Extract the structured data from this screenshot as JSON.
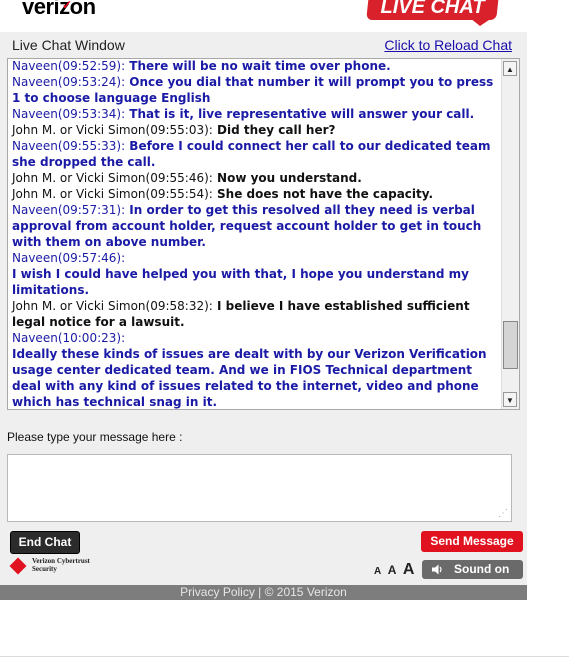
{
  "brand": {
    "logo_text": "verizon",
    "logo_check": "✓",
    "badge_text": "LIVE CHAT"
  },
  "window": {
    "title": "Live Chat Window",
    "reload_link": "Click to Reload Chat"
  },
  "messages": [
    {
      "role": "agent",
      "sender": "Naveen",
      "time": "(09:52:59):",
      "text": " There will be no wait time over phone."
    },
    {
      "role": "agent",
      "sender": "Naveen",
      "time": "(09:53:24):",
      "text": " Once you dial that number it will prompt you to press 1 to choose language English"
    },
    {
      "role": "agent",
      "sender": "Naveen",
      "time": "(09:53:34):",
      "text": " That is it, live representative will answer your call."
    },
    {
      "role": "cust",
      "sender": "John M. or Vicki Simon",
      "time": "(09:55:03):",
      "text": " Did they call her?"
    },
    {
      "role": "agent",
      "sender": "Naveen",
      "time": "(09:55:33):",
      "text": " Before I could connect her call to our dedicated team she dropped the call."
    },
    {
      "role": "cust",
      "sender": "John M. or Vicki Simon",
      "time": "(09:55:46):",
      "text": " Now you understand."
    },
    {
      "role": "cust",
      "sender": "John M. or Vicki Simon",
      "time": "(09:55:54):",
      "text": " She does not have the capacity."
    },
    {
      "role": "agent",
      "sender": "Naveen",
      "time": "(09:57:31):",
      "text": " In order to get this resolved all they need is verbal approval from account holder, request account holder to get in touch with them on above number."
    },
    {
      "role": "agent",
      "sender": "Naveen",
      "time": "(09:57:46):",
      "text": "",
      "newline_text": "I wish I could have helped you with that, I hope you understand my limitations."
    },
    {
      "role": "cust",
      "sender": "John M. or Vicki Simon",
      "time": "(09:58:32):",
      "text": " I believe I have established sufficient legal notice for a lawsuit."
    },
    {
      "role": "agent",
      "sender": "Naveen",
      "time": "(10:00:23):",
      "text": "",
      "newline_text": "Ideally these kinds of issues are dealt with by our Verizon Verification usage center dedicated team. And we in FIOS Technical department deal with any kind of issues related to the internet, video and phone which has technical snag in it."
    }
  ],
  "scroll": {
    "up_icon": "▲",
    "down_icon": "▼",
    "position": 0.9
  },
  "compose": {
    "label": "Please type your message here :",
    "value": "",
    "grip": "⋰"
  },
  "buttons": {
    "end_chat": "End Chat",
    "send_message": "Send Message",
    "sound_on": "Sound on"
  },
  "security": {
    "badge_text": "Verizon Cybertrust Security"
  },
  "font_sizes": {
    "small": "A",
    "medium": "A",
    "large": "A"
  },
  "footer": {
    "text": "Privacy Policy | © 2015 Verizon"
  },
  "colors": {
    "agent_text": "#1a1aa6",
    "customer_text": "#111111",
    "send_button": "#e1121f",
    "end_button": "#2b2b2b"
  }
}
